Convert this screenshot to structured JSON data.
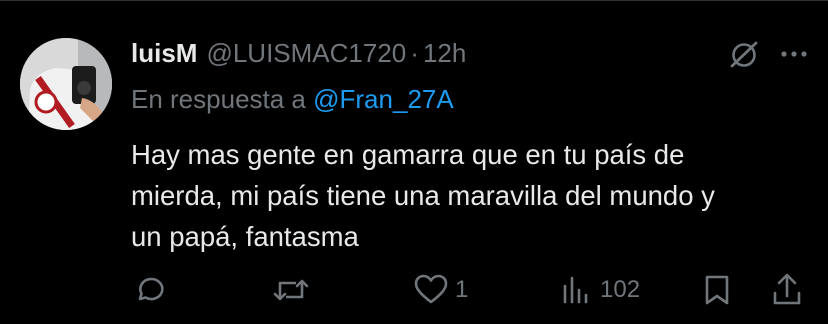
{
  "tweet": {
    "author": {
      "display_name": "luisM",
      "handle": "@LUISMAC1720",
      "separator": "·",
      "time": "12h"
    },
    "reply_prefix": "En respuesta a",
    "reply_to": "@Fran_27A",
    "text_lines": [
      "Hay mas gente en gamarra que en tu país de",
      "mierda, mi país tiene una maravilla del mundo y",
      "un papá, fantasma"
    ],
    "stats": {
      "replies": "",
      "retweets": "",
      "likes": "1",
      "views": "102"
    }
  },
  "icons": {
    "header": [
      "grok-icon",
      "more-icon"
    ],
    "actions": [
      "reply-icon",
      "retweet-icon",
      "like-icon",
      "views-icon",
      "bookmark-icon",
      "share-icon"
    ]
  },
  "colors": {
    "background": "#000000",
    "primary_text": "#e7e9ea",
    "secondary_text": "#71767b",
    "link": "#1d9bf0",
    "divider": "#2f3336"
  }
}
